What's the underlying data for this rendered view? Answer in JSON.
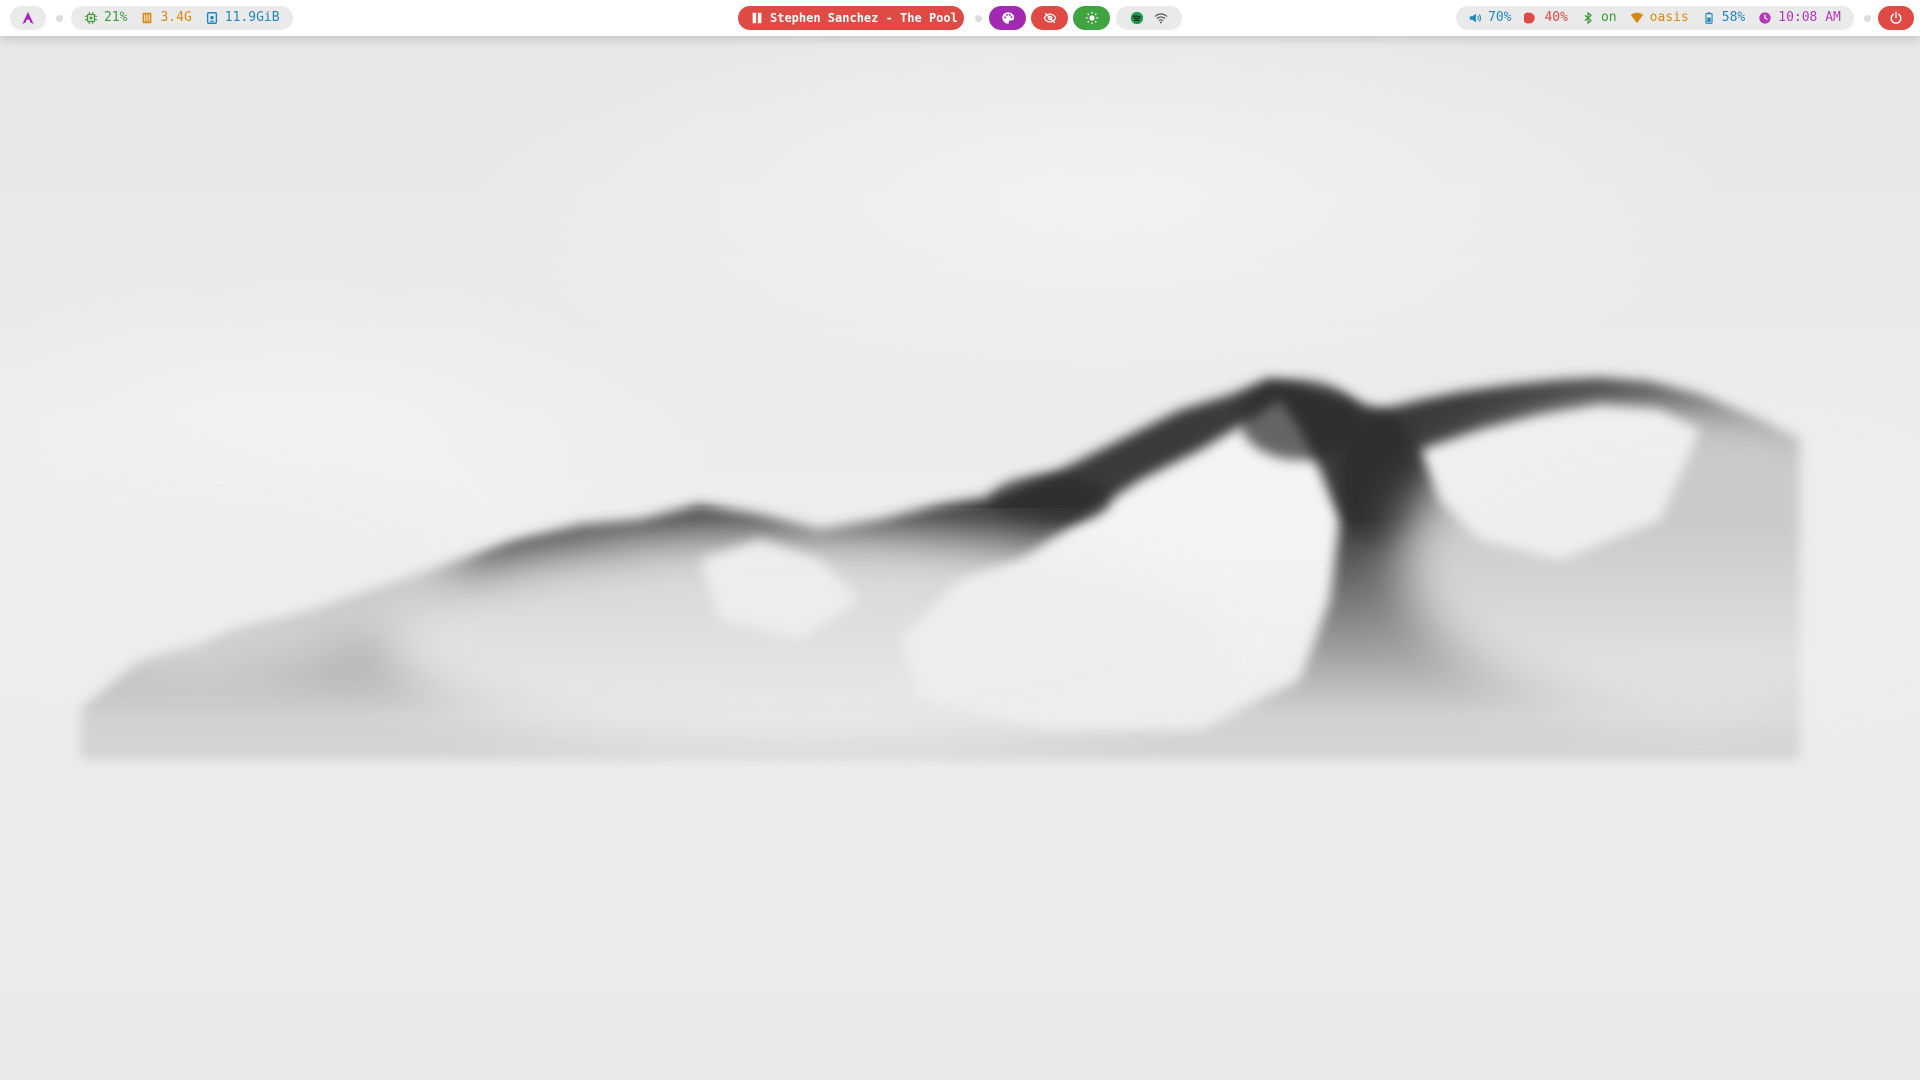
{
  "colors": {
    "accent_red": "#e04a45",
    "accent_magenta": "#a22ab2",
    "accent_green": "#3fa43f",
    "cpu": "#3b9b3b",
    "memory": "#d78a12",
    "disk": "#1f87bf",
    "volume": "#1f87bf",
    "brightness": "#e04a45",
    "bluetooth": "#3b9b3b",
    "network": "#d78a12",
    "battery": "#1f87bf",
    "clock": "#b23ab8"
  },
  "launcher": {
    "icon": "arch-logo-icon"
  },
  "system": {
    "cpu": {
      "icon": "cpu-chip-icon",
      "value": "21%"
    },
    "memory": {
      "icon": "memory-icon",
      "value": "3.4G"
    },
    "disk": {
      "icon": "disk-icon",
      "value": "11.9GiB"
    }
  },
  "media": {
    "icon": "pause-icon",
    "title": "Stephen Sanchez - The Pool"
  },
  "quick_actions": [
    {
      "icon": "palette-icon"
    },
    {
      "icon": "eye-off-icon"
    },
    {
      "icon": "brightness-icon"
    }
  ],
  "tray": [
    {
      "icon": "spotify-icon"
    },
    {
      "icon": "wifi-icon"
    }
  ],
  "status": {
    "volume": {
      "icon": "speaker-icon",
      "value": "70%"
    },
    "brightness": {
      "icon": "moon-icon",
      "value": "40%"
    },
    "bluetooth": {
      "icon": "bluetooth-icon",
      "value": "on"
    },
    "network": {
      "icon": "wifi-signal-icon",
      "value": "oasis"
    },
    "battery": {
      "icon": "battery-icon",
      "value": "58%"
    },
    "clock": {
      "icon": "clock-icon",
      "value": "10:08 AM"
    }
  },
  "power": {
    "icon": "power-icon"
  }
}
